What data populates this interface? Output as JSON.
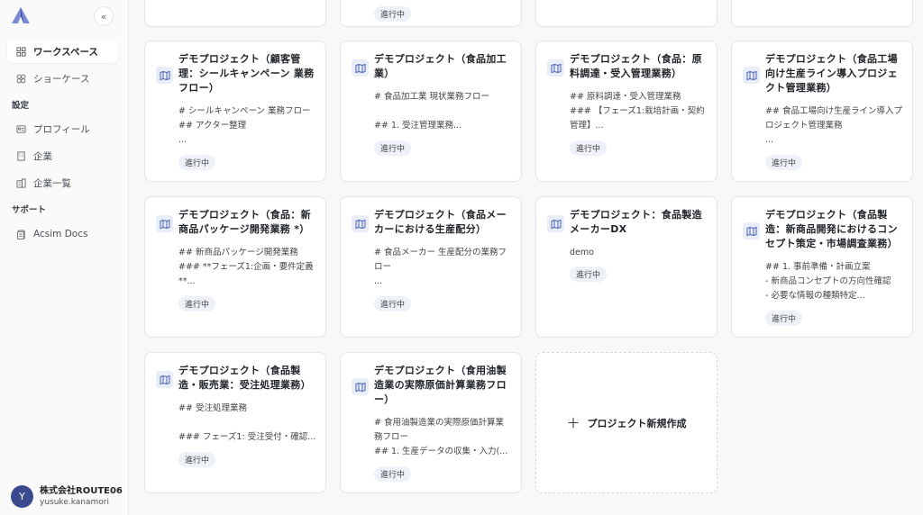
{
  "sidebar": {
    "nav": [
      {
        "label": "ワークスペース",
        "icon": "grid-icon",
        "active": true
      },
      {
        "label": "ショーケース",
        "icon": "pattern-icon",
        "active": false
      }
    ],
    "settings_label": "設定",
    "settings_items": [
      {
        "label": "プロフィール",
        "icon": "id-card-icon"
      },
      {
        "label": "企業",
        "icon": "building-icon"
      },
      {
        "label": "企業一覧",
        "icon": "building-list-icon"
      }
    ],
    "support_label": "サポート",
    "support_items": [
      {
        "label": "Acsim Docs",
        "icon": "document-icon"
      }
    ],
    "user": {
      "initial": "Y",
      "company": "株式会社ROUTE06",
      "id": "yusuke.kanamori"
    }
  },
  "top_row_badges": [
    "進行中"
  ],
  "cards": [
    {
      "title": "デモプロジェクト（顧客管理：シールキャンペーン 業務フロー）",
      "desc": "# シールキャンペーン 業務フロー\n## アクター整理\n...",
      "status": "進行中"
    },
    {
      "title": "デモプロジェクト（食品加工業）",
      "desc": "# 食品加工業 現状業務フロー\n\n## 1. 受注管理業務...",
      "status": "進行中"
    },
    {
      "title": "デモプロジェクト（食品：原料調達・受入管理業務）",
      "desc": "## 原料調達・受入管理業務\n### 【フェーズ1:栽培計画・契約管理】...",
      "status": "進行中"
    },
    {
      "title": "デモプロジェクト（食品工場向け生産ライン導入プロジェクト管理業務）",
      "desc": "## 食品工場向け生産ライン導入プロジェクト管理業務\n...",
      "status": "進行中"
    },
    {
      "title": "デモプロジェクト（食品：新商品パッケージ開発業務 *）",
      "desc": "## 新商品パッケージ開発業務\n### **フェーズ1:企画・要件定義**...",
      "status": "進行中"
    },
    {
      "title": "デモプロジェクト（食品メーカーにおける生産配分）",
      "desc": "# 食品メーカー 生産配分の業務フロー\n...",
      "status": "進行中"
    },
    {
      "title": "デモプロジェクト：食品製造メーカーDX",
      "desc": "demo",
      "status": "進行中"
    },
    {
      "title": "デモプロジェクト（食品製造：新商品開発におけるコンセプト策定・市場調査業務）",
      "desc": "## 1. 事前準備・計画立案\n- 新商品コンセプトの方向性確認\n- 必要な情報の種類特定...",
      "status": "進行中"
    },
    {
      "title": "デモプロジェクト（食品製造・販売業：受注処理業務）",
      "desc": "## 受注処理業務\n\n### フェーズ1: 受注受付・確認...",
      "status": "進行中"
    },
    {
      "title": "デモプロジェクト（食用油製造業の実際原価計算業務フロー）",
      "desc": "# 食用油製造業の実際原価計算業務フロー\n## 1. 生産データの収集・入力(...",
      "status": "進行中"
    }
  ],
  "new_project_label": "プロジェクト新規作成"
}
